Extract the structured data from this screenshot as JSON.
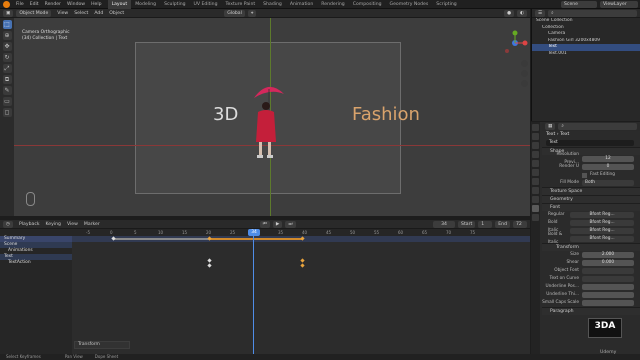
{
  "topbar": {
    "menus": [
      "File",
      "Edit",
      "Render",
      "Window",
      "Help"
    ],
    "workspaces": [
      "Layout",
      "Modeling",
      "Sculpting",
      "UV Editing",
      "Texture Paint",
      "Shading",
      "Animation",
      "Rendering",
      "Compositing",
      "Geometry Nodes",
      "Scripting"
    ],
    "active": "Layout",
    "scene": "Scene",
    "viewlayer": "ViewLayer"
  },
  "viewport": {
    "mode": "Object Mode",
    "menus": [
      "View",
      "Select",
      "Add",
      "Object"
    ],
    "orientation": "Global",
    "camera_label": "Camera Orthographic",
    "collection_label": "(34) Collection | Text",
    "text_3d": "3D",
    "text_fashion": "Fashion"
  },
  "timeline": {
    "menus": [
      "Playback",
      "Keying",
      "View",
      "Marker"
    ],
    "current_frame": "34",
    "start_label": "Start",
    "start": "1",
    "end_label": "End",
    "end": "72",
    "ticks": [
      "-5",
      "0",
      "5",
      "10",
      "15",
      "20",
      "25",
      "30",
      "35",
      "40",
      "45",
      "50",
      "55",
      "60",
      "65",
      "70",
      "75"
    ],
    "channels": [
      "Summary",
      "Scene",
      "Animations",
      "Text",
      "TextAction"
    ],
    "footer": "Transform"
  },
  "status": {
    "left": "Select Keyframes",
    "mid": "Pan View",
    "right": "Dope Sheet"
  },
  "outliner": {
    "items": [
      "Scene Collection",
      "Collection",
      "Camera",
      "Fashion Girl  3200x4809",
      "Text",
      "Text.001"
    ]
  },
  "properties": {
    "crumb": "Text",
    "sub": "Text",
    "data_name": "Text",
    "shape": "Shape",
    "res_preview_label": "Resolution Previ...",
    "res_preview": "12",
    "render_u_label": "Render U",
    "render_u": "0",
    "fast_editing": "Fast Editing",
    "fill_mode_label": "Fill Mode",
    "fill_mode": "Both",
    "sections": [
      "Texture Space",
      "Geometry",
      "Font"
    ],
    "font_rows": [
      {
        "label": "Regular",
        "value": "Bfont Reg..."
      },
      {
        "label": "Bold",
        "value": "Bfont Reg..."
      },
      {
        "label": "Italic",
        "value": "Bfont Reg..."
      },
      {
        "label": "Bold & Italic",
        "value": "Bfont Reg..."
      }
    ],
    "transform": "Transform",
    "size_label": "Size",
    "size": "2.000",
    "shear_label": "Shear",
    "shear": "0.000",
    "object_font": "Object Font",
    "text_on_curve": "Text on Curve",
    "underline_pos": "Underline Pos...",
    "underline_thick": "Underline Thi...",
    "small_caps": "Small Caps Scale",
    "paragraph": "Paragraph"
  },
  "watermark": "3DA",
  "udemy": "Udemy"
}
